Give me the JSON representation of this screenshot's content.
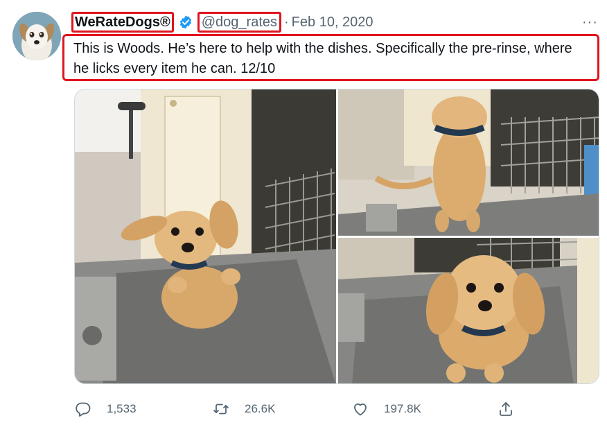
{
  "tweet": {
    "display_name": "WeRateDogs®",
    "handle": "@dog_rates",
    "separator": "·",
    "date": "Feb 10, 2020",
    "more_label": "···",
    "text": "This is Woods. He’s here to help with the dishes. Specifically the pre-rinse, where he licks every item he can. 12/10"
  },
  "actions": {
    "reply": {
      "icon": "reply-icon",
      "count": "1,533"
    },
    "retweet": {
      "icon": "retweet-icon",
      "count": "26.6K"
    },
    "like": {
      "icon": "heart-icon",
      "count": "197.8K"
    },
    "share": {
      "icon": "share-icon"
    }
  },
  "colors": {
    "annotation_box": "#e0141e",
    "verified_badge": "#1d9bf0",
    "secondary_text": "#536471",
    "primary_text": "#0f1419"
  }
}
